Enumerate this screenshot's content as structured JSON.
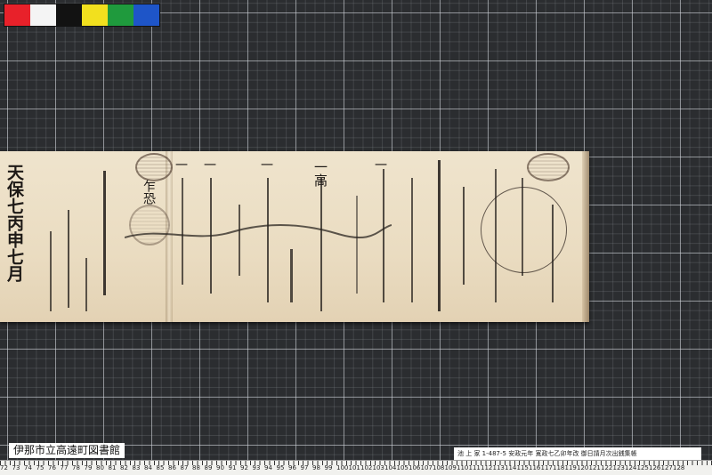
{
  "color_checker": {
    "swatches": [
      "#e8212a",
      "#f4f4f4",
      "#121212",
      "#f2e01e",
      "#1f9a3d",
      "#1e55c8"
    ]
  },
  "document": {
    "columns": [
      "天保七丙申七月",
      "乍恐",
      "一高",
      "一",
      "一",
      "一",
      "一"
    ]
  },
  "labels": {
    "library": "伊那市立高遠町図書館",
    "catalog": "池  上  家    1-487-5 安政元年 寛政七乙卯年改 御日請月次出銭集帳"
  },
  "ruler": {
    "numbers": [
      "72",
      "73",
      "74",
      "75",
      "76",
      "77",
      "78",
      "79",
      "80",
      "81",
      "82",
      "83",
      "84",
      "85",
      "86",
      "87",
      "88",
      "89",
      "90",
      "91",
      "92",
      "93",
      "94",
      "95",
      "96",
      "97",
      "98",
      "99",
      "100",
      "101",
      "102",
      "103",
      "104",
      "105",
      "106",
      "107",
      "108",
      "109",
      "110",
      "111",
      "112",
      "113",
      "114",
      "115",
      "116",
      "117",
      "118",
      "119",
      "120",
      "121",
      "122",
      "123",
      "124",
      "125",
      "126",
      "127",
      "128"
    ]
  }
}
